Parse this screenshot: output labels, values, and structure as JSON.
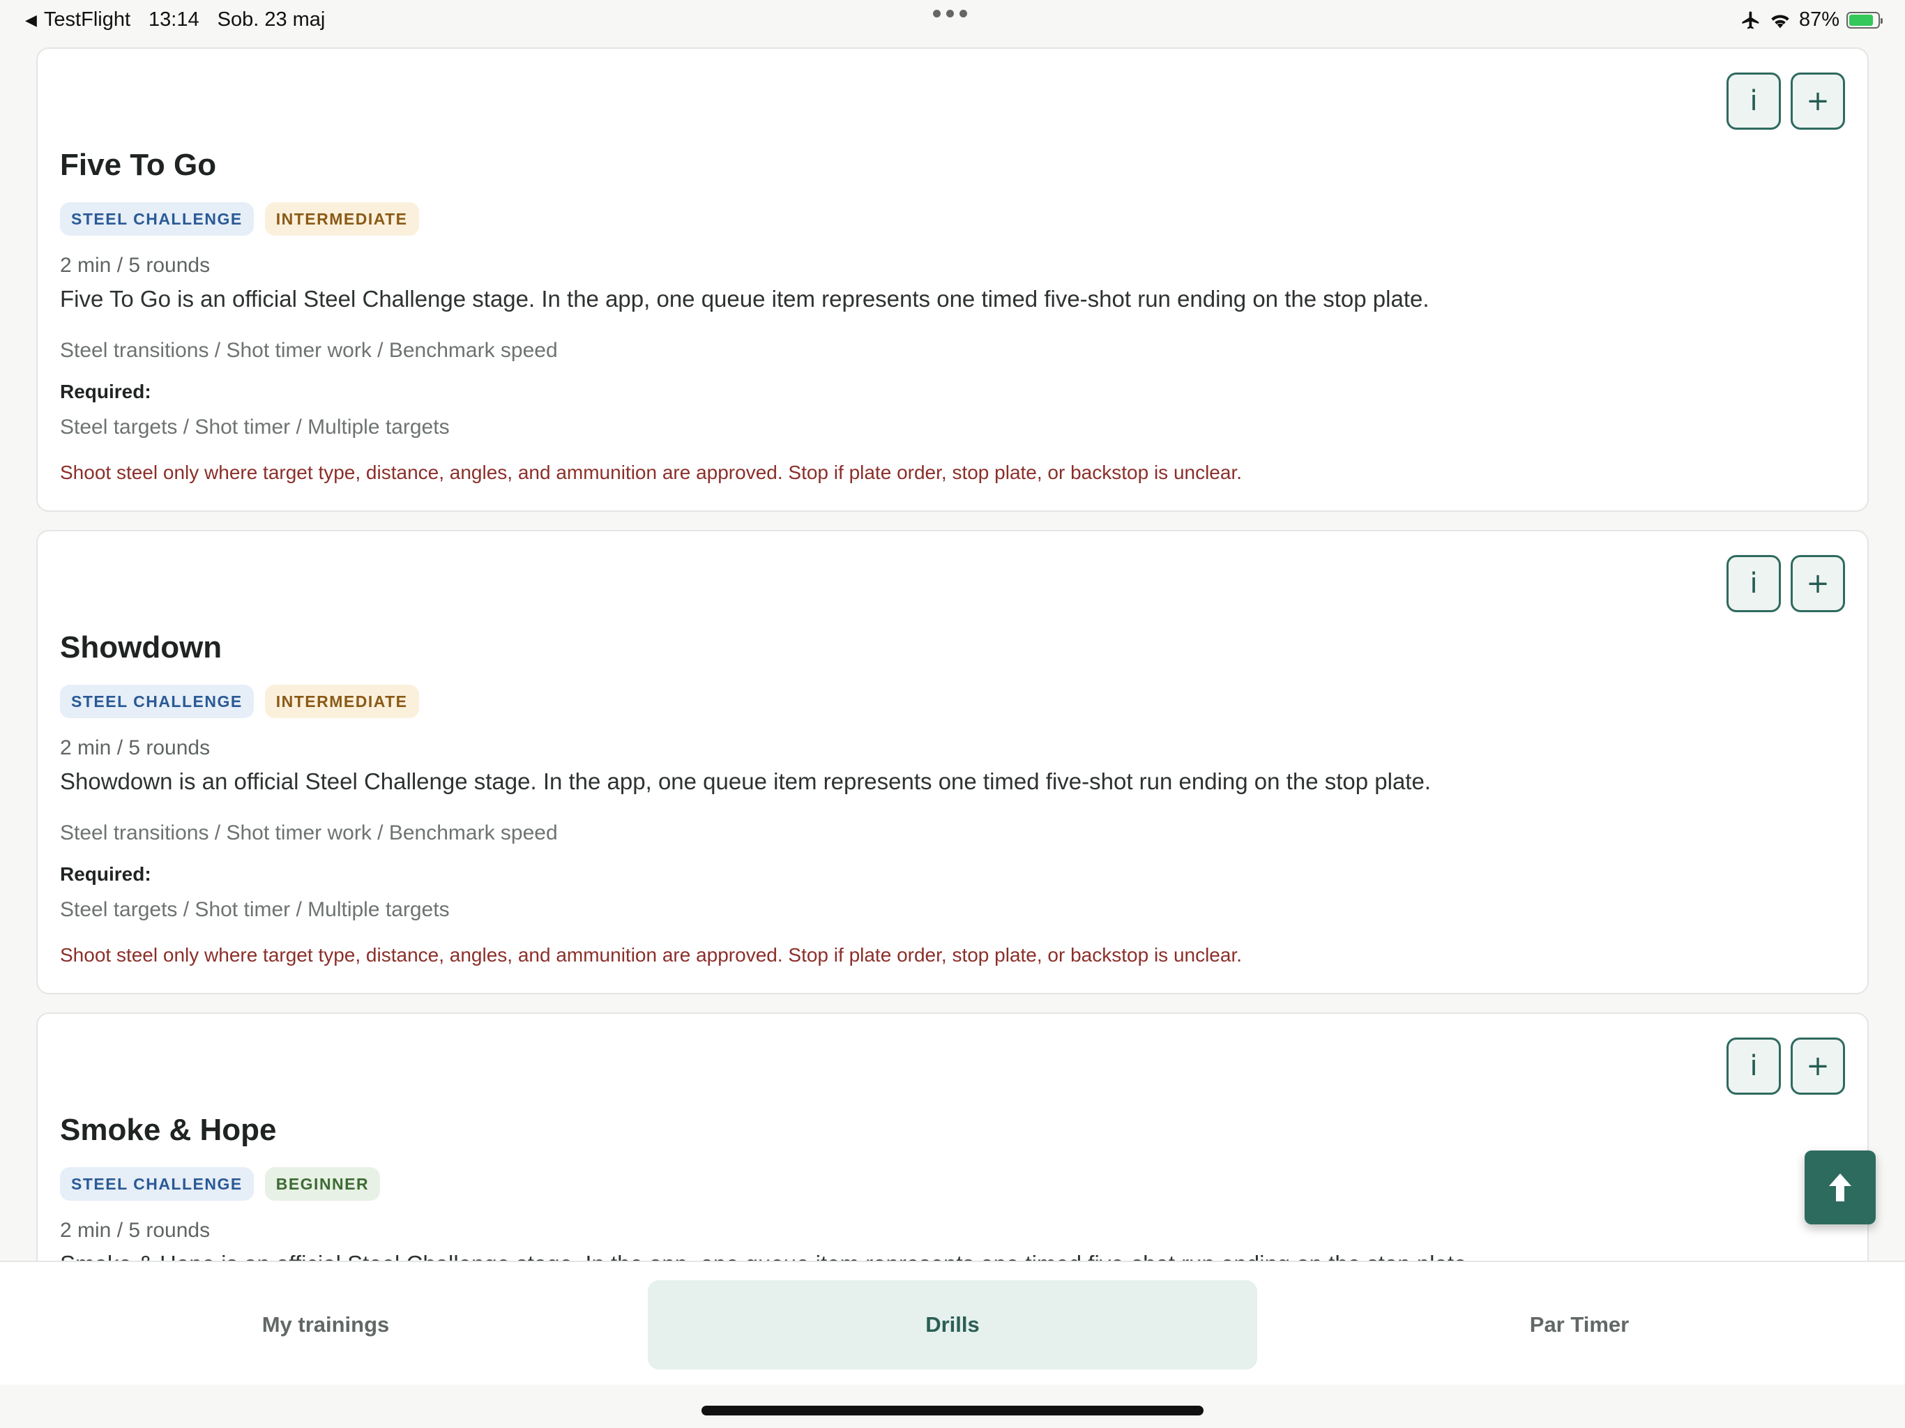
{
  "status_bar": {
    "back_app": "TestFlight",
    "time": "13:14",
    "date": "Sob. 23 maj",
    "battery": "87%"
  },
  "drills": [
    {
      "title": "Five To Go",
      "tags": [
        "STEEL CHALLENGE",
        "INTERMEDIATE"
      ],
      "meta": "2 min / 5 rounds",
      "description": "Five To Go is an official Steel Challenge stage. In the app, one queue item represents one timed five-shot run ending on the stop plate.",
      "focus": "Steel transitions / Shot timer work / Benchmark speed",
      "required_label": "Required:",
      "equipment": "Steel targets / Shot timer / Multiple targets",
      "warning": "Shoot steel only where target type, distance, angles, and ammunition are approved. Stop if plate order, stop plate, or backstop is unclear.",
      "info_label": "i",
      "add_label": "+"
    },
    {
      "title": "Showdown",
      "tags": [
        "STEEL CHALLENGE",
        "INTERMEDIATE"
      ],
      "meta": "2 min / 5 rounds",
      "description": "Showdown is an official Steel Challenge stage. In the app, one queue item represents one timed five-shot run ending on the stop plate.",
      "focus": "Steel transitions / Shot timer work / Benchmark speed",
      "required_label": "Required:",
      "equipment": "Steel targets / Shot timer / Multiple targets",
      "warning": "Shoot steel only where target type, distance, angles, and ammunition are approved. Stop if plate order, stop plate, or backstop is unclear.",
      "info_label": "i",
      "add_label": "+"
    },
    {
      "title": "Smoke & Hope",
      "tags": [
        "STEEL CHALLENGE",
        "BEGINNER"
      ],
      "meta": "2 min / 5 rounds",
      "description": "Smoke & Hope is an official Steel Challenge stage. In the app, one queue item represents one timed five-shot run ending on the stop plate.",
      "info_label": "i",
      "add_label": "+"
    }
  ],
  "tabs": [
    "My trainings",
    "Drills",
    "Par Timer"
  ],
  "active_tab": "Drills",
  "colors": {
    "accent": "#2d6b5f",
    "warning_text": "#8b2f2a",
    "tag_steel_bg": "#e6eef8",
    "tag_intermediate_bg": "#fbf0dc",
    "tag_beginner_bg": "#e8f1e5"
  }
}
